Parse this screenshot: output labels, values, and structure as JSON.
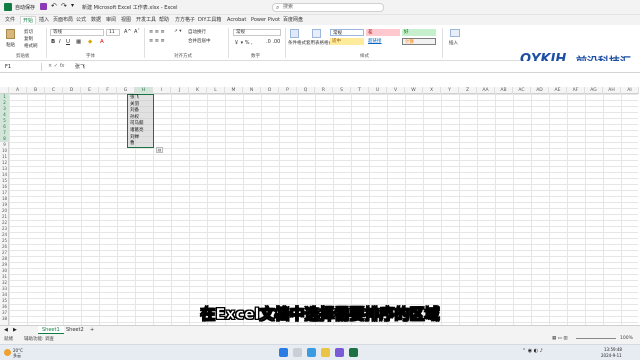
{
  "titlebar": {
    "autosave": "自动保存",
    "title": "新建 Microsoft Excel 工作表.xlsx  -  Excel",
    "search_placeholder": "搜索"
  },
  "menu": {
    "tabs": [
      "文件",
      "开始",
      "插入",
      "页面布局",
      "公式",
      "数据",
      "审阅",
      "视图",
      "开发工具",
      "帮助",
      "方方格子",
      "DIY工具箱",
      "Acrobat",
      "Power Pivot",
      "百度网盘"
    ]
  },
  "ribbon": {
    "clipboard": {
      "paste": "粘贴",
      "cut": "剪切",
      "copy": "复制",
      "format_painter": "格式刷",
      "label": "剪贴板"
    },
    "font": {
      "name": "等线",
      "size": "11",
      "label": "字体"
    },
    "alignment": {
      "wrap": "自动换行",
      "merge": "合并后居中",
      "label": "对齐方式"
    },
    "number": {
      "format": "常规",
      "label": "数字"
    },
    "styles": {
      "conditional": "条件格式",
      "table_format": "套用表格格式",
      "cells": [
        "常规",
        "差",
        "好",
        "适中",
        "超链接",
        "计算"
      ],
      "label": "样式"
    },
    "insert": "插入"
  },
  "logo": {
    "text": "QYKJH",
    "cn": "前沿科技汇",
    "sub": "FRONTIER TECHNOLOGY SUMMIT"
  },
  "formula_bar": {
    "cell_ref": "F1",
    "fx": "fx",
    "content": "张飞"
  },
  "grid": {
    "columns": [
      "A",
      "B",
      "C",
      "D",
      "E",
      "F",
      "G",
      "H",
      "I",
      "J",
      "K",
      "L",
      "M",
      "N",
      "O",
      "P",
      "Q",
      "R",
      "S",
      "T",
      "U",
      "V",
      "W",
      "X",
      "Y",
      "Z",
      "AA",
      "AB",
      "AC",
      "AD",
      "AE",
      "AF",
      "AG",
      "AH",
      "AI"
    ],
    "row_count": 38,
    "selected_values": [
      "张飞",
      "关羽",
      "刘备",
      "孙权",
      "司马懿",
      "诸葛亮",
      "刘婵",
      "曹"
    ]
  },
  "subtitle": "在Excel文档中选择需要排序的区域",
  "sheets": {
    "tabs": [
      "Sheet1",
      "Sheet2"
    ],
    "add": "+"
  },
  "status": {
    "ready": "就绪",
    "accessibility": "辅助功能: 调查",
    "zoom": "100%"
  },
  "taskbar": {
    "weather_temp": "20°C",
    "weather_desc": "多云",
    "time": "13:59:48",
    "date": "2024-9-11"
  },
  "colors": {
    "accent": "#107c41",
    "selection_border": "#1e7145",
    "logo_blue": "#1d4fa3"
  }
}
